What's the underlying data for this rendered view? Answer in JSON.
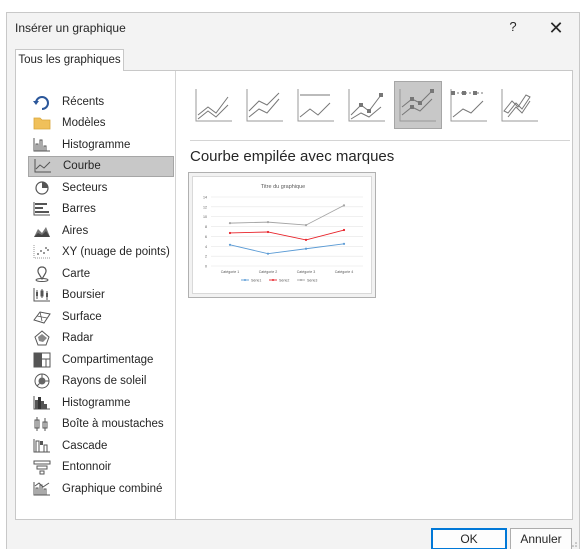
{
  "window": {
    "title": "Insérer un graphique",
    "help": "?",
    "close": "✕"
  },
  "tab": {
    "label": "Tous les graphiques"
  },
  "sidebar": {
    "items": [
      {
        "label": "Récents",
        "icon": "recent-icon"
      },
      {
        "label": "Modèles",
        "icon": "folder-icon"
      },
      {
        "label": "Histogramme",
        "icon": "column-chart-icon"
      },
      {
        "label": "Courbe",
        "icon": "line-chart-icon"
      },
      {
        "label": "Secteurs",
        "icon": "pie-chart-icon"
      },
      {
        "label": "Barres",
        "icon": "bar-chart-icon"
      },
      {
        "label": "Aires",
        "icon": "area-chart-icon"
      },
      {
        "label": "XY (nuage de points)",
        "icon": "scatter-chart-icon"
      },
      {
        "label": "Carte",
        "icon": "map-chart-icon"
      },
      {
        "label": "Boursier",
        "icon": "stock-chart-icon"
      },
      {
        "label": "Surface",
        "icon": "surface-chart-icon"
      },
      {
        "label": "Radar",
        "icon": "radar-chart-icon"
      },
      {
        "label": "Compartimentage",
        "icon": "treemap-chart-icon"
      },
      {
        "label": "Rayons de soleil",
        "icon": "sunburst-chart-icon"
      },
      {
        "label": "Histogramme",
        "icon": "histogram-chart-icon"
      },
      {
        "label": "Boîte à moustaches",
        "icon": "box-whisker-chart-icon"
      },
      {
        "label": "Cascade",
        "icon": "waterfall-chart-icon"
      },
      {
        "label": "Entonnoir",
        "icon": "funnel-chart-icon"
      },
      {
        "label": "Graphique combiné",
        "icon": "combo-chart-icon"
      }
    ],
    "selected_index": 3
  },
  "subtypes": {
    "selected_index": 4,
    "items": [
      "line-icon",
      "stacked-line-icon",
      "percent-stacked-line-icon",
      "line-markers-icon",
      "stacked-line-markers-icon",
      "percent-stacked-line-markers-icon",
      "3d-line-icon"
    ]
  },
  "selected_type_title": "Courbe empilée avec marques",
  "preview": {
    "chart_data": {
      "type": "line",
      "title": "Titre du graphique",
      "categories": [
        "Catégorie 1",
        "Catégorie 2",
        "Catégorie 3",
        "Catégorie 4"
      ],
      "series": [
        {
          "name": "Série1",
          "values": [
            4.3,
            2.5,
            3.5,
            4.5
          ],
          "color": "#5b9bd5"
        },
        {
          "name": "Série2",
          "values": [
            6.7,
            6.9,
            5.3,
            7.3
          ],
          "color": "#e8232a"
        },
        {
          "name": "Série3",
          "values": [
            8.7,
            8.9,
            8.3,
            12.3
          ],
          "color": "#a5a5a5"
        }
      ],
      "ylim": [
        0,
        14
      ],
      "yticks": [
        "0",
        "2",
        "4",
        "6",
        "8",
        "10",
        "12",
        "14"
      ],
      "grid": true,
      "legend": "bottom"
    }
  },
  "buttons": {
    "ok": "OK",
    "cancel": "Annuler"
  }
}
